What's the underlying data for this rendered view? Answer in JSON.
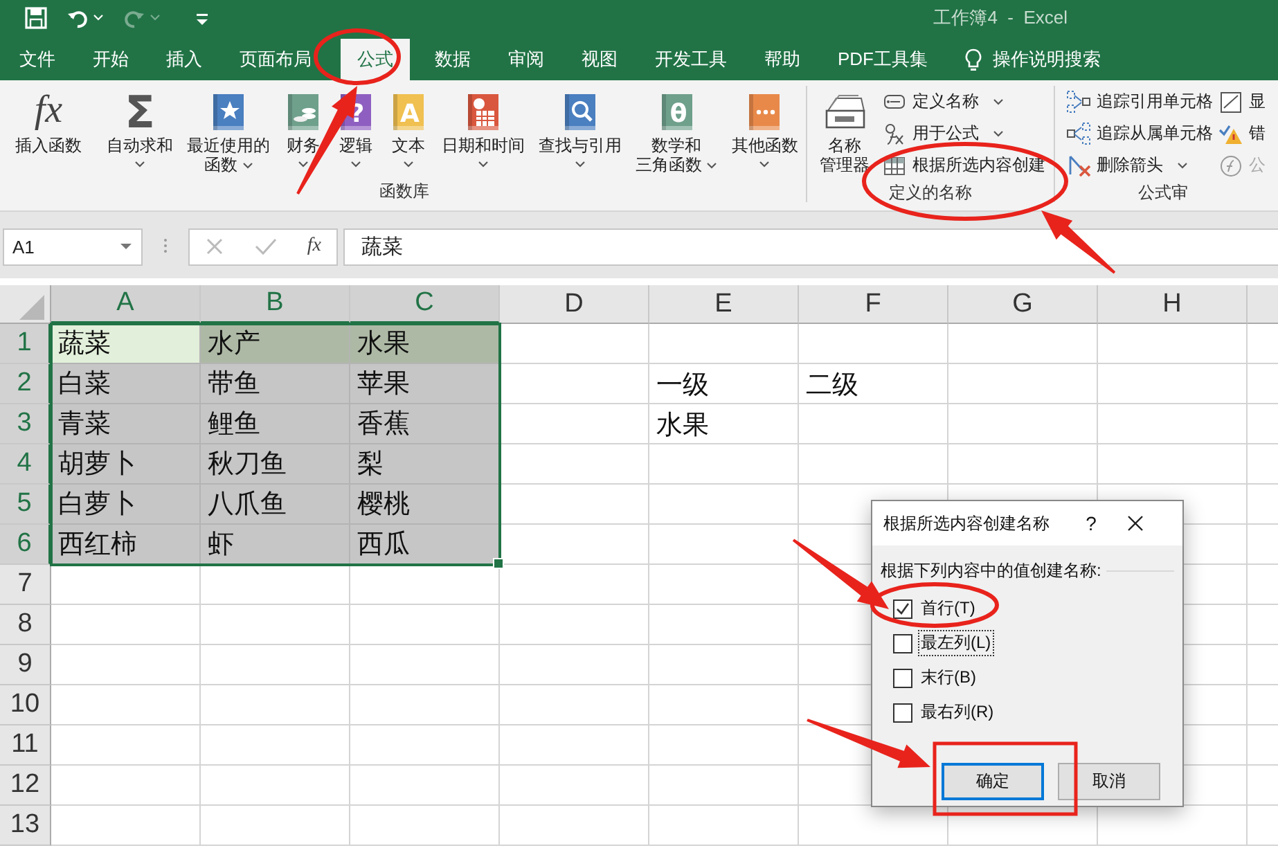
{
  "window": {
    "title": "工作簿4  -  Excel"
  },
  "quick_access": [
    {
      "kind": "save",
      "disabled": false
    },
    {
      "kind": "undo",
      "disabled": false
    },
    {
      "kind": "redo",
      "disabled": true
    },
    {
      "kind": "customize",
      "disabled": false
    }
  ],
  "tabs": [
    {
      "label": "文件",
      "selected": false
    },
    {
      "label": "开始",
      "selected": false
    },
    {
      "label": "插入",
      "selected": false
    },
    {
      "label": "页面布局",
      "selected": false
    },
    {
      "label": "公式",
      "selected": true
    },
    {
      "label": "数据",
      "selected": false
    },
    {
      "label": "审阅",
      "selected": false
    },
    {
      "label": "视图",
      "selected": false
    },
    {
      "label": "开发工具",
      "selected": false
    },
    {
      "label": "帮助",
      "selected": false
    },
    {
      "label": "PDF工具集",
      "selected": false
    }
  ],
  "tell_me": {
    "label": "操作说明搜索"
  },
  "ribbon": {
    "groups": [
      {
        "label": "函数库",
        "buttons": [
          {
            "glyph": "fx",
            "lines": [
              "插入函数"
            ],
            "has_menu": false
          },
          {
            "glyph": "Σ",
            "lines": [
              "自动求和"
            ],
            "has_menu": true
          },
          {
            "lines": [
              "最近使用的",
              "函数"
            ],
            "has_menu": true
          },
          {
            "lines": [
              "财务"
            ],
            "has_menu": true
          },
          {
            "glyph": "?",
            "lines": [
              "逻辑"
            ],
            "has_menu": true
          },
          {
            "glyph": "A",
            "lines": [
              "文本"
            ],
            "has_menu": true
          },
          {
            "lines": [
              "日期和时间"
            ],
            "has_menu": true
          },
          {
            "lines": [
              "查找与引用"
            ],
            "has_menu": true
          },
          {
            "glyph": "θ",
            "lines": [
              "数学和",
              "三角函数"
            ],
            "has_menu": true
          },
          {
            "lines": [
              "其他函数"
            ],
            "has_menu": true
          }
        ]
      },
      {
        "label": "定义的名称",
        "buttons": [
          {
            "lines": [
              "名称",
              "管理器"
            ],
            "has_menu": false
          }
        ],
        "small": [
          {
            "label": "定义名称",
            "has_menu": true,
            "disabled": false
          },
          {
            "label": "用于公式",
            "has_menu": true,
            "disabled": false
          },
          {
            "label": "根据所选内容创建",
            "has_menu": false,
            "disabled": false
          }
        ]
      },
      {
        "label": "公式审",
        "small": [
          {
            "label": "追踪引用单元格",
            "has_menu": false,
            "disabled": false
          },
          {
            "label": "追踪从属单元格",
            "has_menu": false,
            "disabled": false
          },
          {
            "label": "删除箭头",
            "has_menu": true,
            "disabled": false
          }
        ],
        "small2": [
          {
            "label": "显",
            "has_menu": false,
            "disabled": false
          },
          {
            "label": "错",
            "has_menu": false,
            "disabled": false
          },
          {
            "label": "公",
            "has_menu": false,
            "disabled": true
          }
        ]
      }
    ]
  },
  "formula_bar": {
    "name_box": "A1",
    "fx": "fx",
    "value": "蔬菜"
  },
  "sheet": {
    "columns": [
      "A",
      "B",
      "C",
      "D",
      "E",
      "F",
      "G",
      "H"
    ],
    "rows": [
      {
        "header": "1",
        "cells": [
          {
            "text": "蔬菜",
            "selected": true,
            "active": true,
            "preview": false
          },
          {
            "text": "水产",
            "selected": true,
            "active": false,
            "preview": true
          },
          {
            "text": "水果",
            "selected": true,
            "active": false,
            "preview": true
          }
        ]
      },
      {
        "header": "2",
        "cells": [
          {
            "text": "白菜",
            "selected": true,
            "active": false,
            "preview": false
          },
          {
            "text": "带鱼",
            "selected": true,
            "active": false,
            "preview": false
          },
          {
            "text": "苹果",
            "selected": true,
            "active": false,
            "preview": false
          }
        ],
        "side_cells": [
          {
            "text": "一级"
          },
          {
            "text": "二级"
          }
        ]
      },
      {
        "header": "3",
        "cells": [
          {
            "text": "青菜",
            "selected": true,
            "active": false,
            "preview": false
          },
          {
            "text": "鲤鱼",
            "selected": true,
            "active": false,
            "preview": false
          },
          {
            "text": "香蕉",
            "selected": true,
            "active": false,
            "preview": false
          }
        ],
        "side_cells": [
          {
            "text": "水果"
          }
        ]
      },
      {
        "header": "4",
        "cells": [
          {
            "text": "胡萝卜",
            "selected": true,
            "active": false,
            "preview": false
          },
          {
            "text": "秋刀鱼",
            "selected": true,
            "active": false,
            "preview": false
          },
          {
            "text": "梨",
            "selected": true,
            "active": false,
            "preview": false
          }
        ]
      },
      {
        "header": "5",
        "cells": [
          {
            "text": "白萝卜",
            "selected": true,
            "active": false,
            "preview": false
          },
          {
            "text": "八爪鱼",
            "selected": true,
            "active": false,
            "preview": false
          },
          {
            "text": "樱桃",
            "selected": true,
            "active": false,
            "preview": false
          }
        ]
      },
      {
        "header": "6",
        "cells": [
          {
            "text": "西红柿",
            "selected": true,
            "active": false,
            "preview": false
          },
          {
            "text": "虾",
            "selected": true,
            "active": false,
            "preview": false
          },
          {
            "text": "西瓜",
            "selected": true,
            "active": false,
            "preview": false
          }
        ]
      },
      {
        "header": "7"
      },
      {
        "header": "8"
      },
      {
        "header": "9"
      },
      {
        "header": "10"
      },
      {
        "header": "11"
      },
      {
        "header": "12"
      },
      {
        "header": "13"
      }
    ]
  },
  "dialog": {
    "title": "根据所选内容创建名称",
    "help": "?",
    "group_label": "根据下列内容中的值创建名称:",
    "options": [
      {
        "label": "首行(T)",
        "checked": true,
        "focused": false
      },
      {
        "label": "最左列(L)",
        "checked": false,
        "focused": true
      },
      {
        "label": "末行(B)",
        "checked": false,
        "focused": false
      },
      {
        "label": "最右列(R)",
        "checked": false,
        "focused": false
      }
    ],
    "buttons": [
      {
        "label": "确定",
        "default": true
      },
      {
        "label": "取消",
        "default": false
      }
    ]
  },
  "annotations": [
    {
      "kind": "ellipse"
    },
    {
      "kind": "arrow"
    },
    {
      "kind": "ellipse"
    },
    {
      "kind": "arrow"
    },
    {
      "kind": "ellipse"
    },
    {
      "kind": "arrow"
    },
    {
      "kind": "rect"
    },
    {
      "kind": "arrow"
    }
  ]
}
